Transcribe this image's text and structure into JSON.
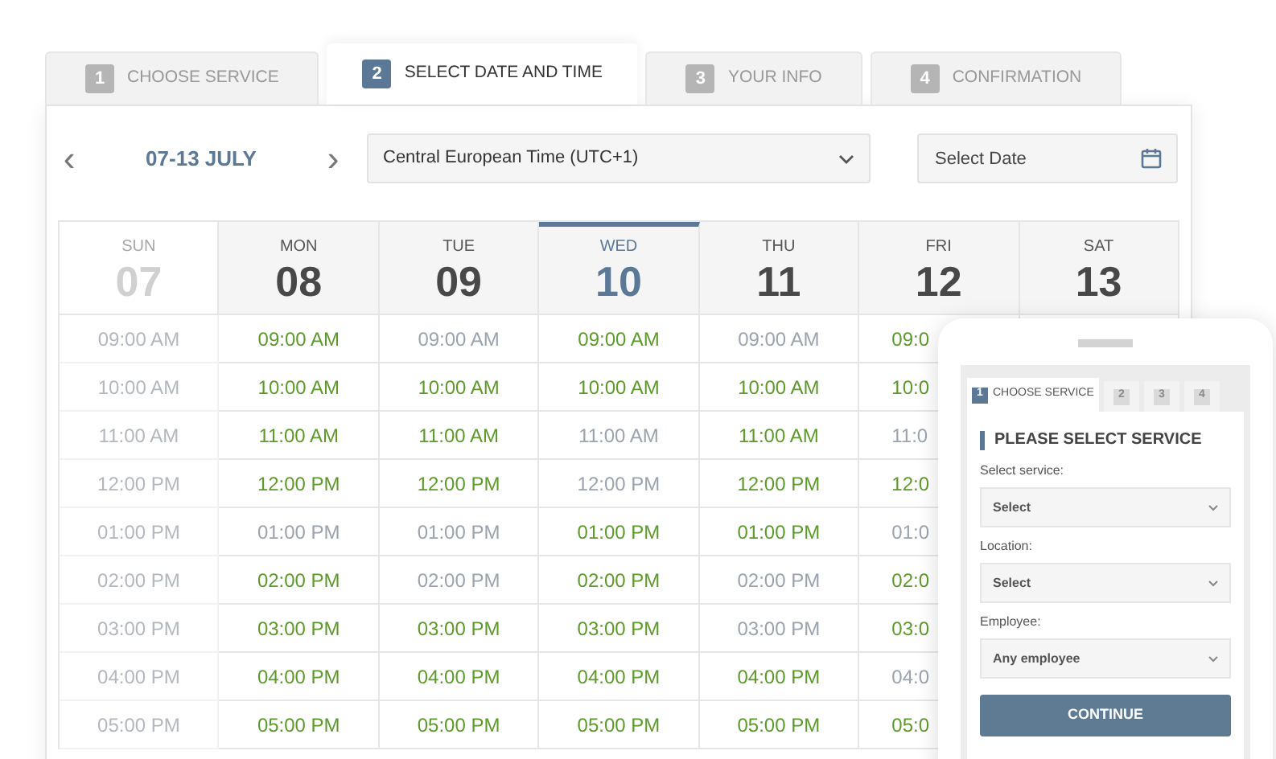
{
  "tabs": [
    {
      "number": "1",
      "label": "CHOOSE SERVICE",
      "selected": false
    },
    {
      "number": "2",
      "label": "SELECT DATE AND TIME",
      "selected": true
    },
    {
      "number": "3",
      "label": "YOUR INFO",
      "selected": false
    },
    {
      "number": "4",
      "label": "CONFIRMATION",
      "selected": false
    }
  ],
  "week_nav": {
    "prev": "‹",
    "range": "07-13 JULY",
    "next": "›"
  },
  "timezone": {
    "value": "Central European Time (UTC+1)"
  },
  "date_field": {
    "placeholder": "Select Date"
  },
  "days": [
    {
      "day": "SUN",
      "date": "07",
      "disabled": true,
      "selected": false,
      "slots": [
        {
          "time": "09:00 AM",
          "available": false
        },
        {
          "time": "10:00 AM",
          "available": false
        },
        {
          "time": "11:00 AM",
          "available": false
        },
        {
          "time": "12:00 PM",
          "available": false
        },
        {
          "time": "01:00 PM",
          "available": false
        },
        {
          "time": "02:00 PM",
          "available": false
        },
        {
          "time": "03:00 PM",
          "available": false
        },
        {
          "time": "04:00 PM",
          "available": false
        },
        {
          "time": "05:00 PM",
          "available": false
        }
      ]
    },
    {
      "day": "MON",
      "date": "08",
      "disabled": false,
      "selected": false,
      "slots": [
        {
          "time": "09:00 AM",
          "available": true
        },
        {
          "time": "10:00 AM",
          "available": true
        },
        {
          "time": "11:00 AM",
          "available": true
        },
        {
          "time": "12:00 PM",
          "available": true
        },
        {
          "time": "01:00 PM",
          "available": false
        },
        {
          "time": "02:00 PM",
          "available": true
        },
        {
          "time": "03:00 PM",
          "available": true
        },
        {
          "time": "04:00 PM",
          "available": true
        },
        {
          "time": "05:00 PM",
          "available": true
        }
      ]
    },
    {
      "day": "TUE",
      "date": "09",
      "disabled": false,
      "selected": false,
      "slots": [
        {
          "time": "09:00 AM",
          "available": false
        },
        {
          "time": "10:00 AM",
          "available": true
        },
        {
          "time": "11:00 AM",
          "available": true
        },
        {
          "time": "12:00 PM",
          "available": true
        },
        {
          "time": "01:00 PM",
          "available": false
        },
        {
          "time": "02:00 PM",
          "available": false
        },
        {
          "time": "03:00 PM",
          "available": true
        },
        {
          "time": "04:00 PM",
          "available": true
        },
        {
          "time": "05:00 PM",
          "available": true
        }
      ]
    },
    {
      "day": "WED",
      "date": "10",
      "disabled": false,
      "selected": true,
      "slots": [
        {
          "time": "09:00 AM",
          "available": true
        },
        {
          "time": "10:00 AM",
          "available": true
        },
        {
          "time": "11:00 AM",
          "available": false
        },
        {
          "time": "12:00 PM",
          "available": false
        },
        {
          "time": "01:00 PM",
          "available": true
        },
        {
          "time": "02:00 PM",
          "available": true
        },
        {
          "time": "03:00 PM",
          "available": true
        },
        {
          "time": "04:00 PM",
          "available": true
        },
        {
          "time": "05:00 PM",
          "available": true
        }
      ]
    },
    {
      "day": "THU",
      "date": "11",
      "disabled": false,
      "selected": false,
      "slots": [
        {
          "time": "09:00 AM",
          "available": false
        },
        {
          "time": "10:00 AM",
          "available": true
        },
        {
          "time": "11:00 AM",
          "available": true
        },
        {
          "time": "12:00 PM",
          "available": true
        },
        {
          "time": "01:00 PM",
          "available": true
        },
        {
          "time": "02:00 PM",
          "available": false
        },
        {
          "time": "03:00 PM",
          "available": false
        },
        {
          "time": "04:00 PM",
          "available": true
        },
        {
          "time": "05:00 PM",
          "available": true
        }
      ]
    },
    {
      "day": "FRI",
      "date": "12",
      "disabled": false,
      "selected": false,
      "slots": [
        {
          "time": "09:0",
          "available": true
        },
        {
          "time": "10:0",
          "available": true
        },
        {
          "time": "11:0",
          "available": false
        },
        {
          "time": "12:0",
          "available": true
        },
        {
          "time": "01:0",
          "available": false
        },
        {
          "time": "02:0",
          "available": true
        },
        {
          "time": "03:0",
          "available": true
        },
        {
          "time": "04:0",
          "available": false
        },
        {
          "time": "05:0",
          "available": true
        }
      ]
    },
    {
      "day": "SAT",
      "date": "13",
      "disabled": false,
      "selected": false
    }
  ],
  "mobile": {
    "tabs": [
      {
        "number": "1",
        "label": "CHOOSE SERVICE",
        "selected": true
      },
      {
        "number": "2",
        "selected": false
      },
      {
        "number": "3",
        "selected": false
      },
      {
        "number": "4",
        "selected": false
      }
    ],
    "heading": "PLEASE SELECT SERVICE",
    "fields": [
      {
        "label": "Select service:",
        "value": "Select"
      },
      {
        "label": "Location:",
        "value": "Select"
      },
      {
        "label": "Employee:",
        "value": "Any employee"
      }
    ],
    "button": "CONTINUE"
  }
}
